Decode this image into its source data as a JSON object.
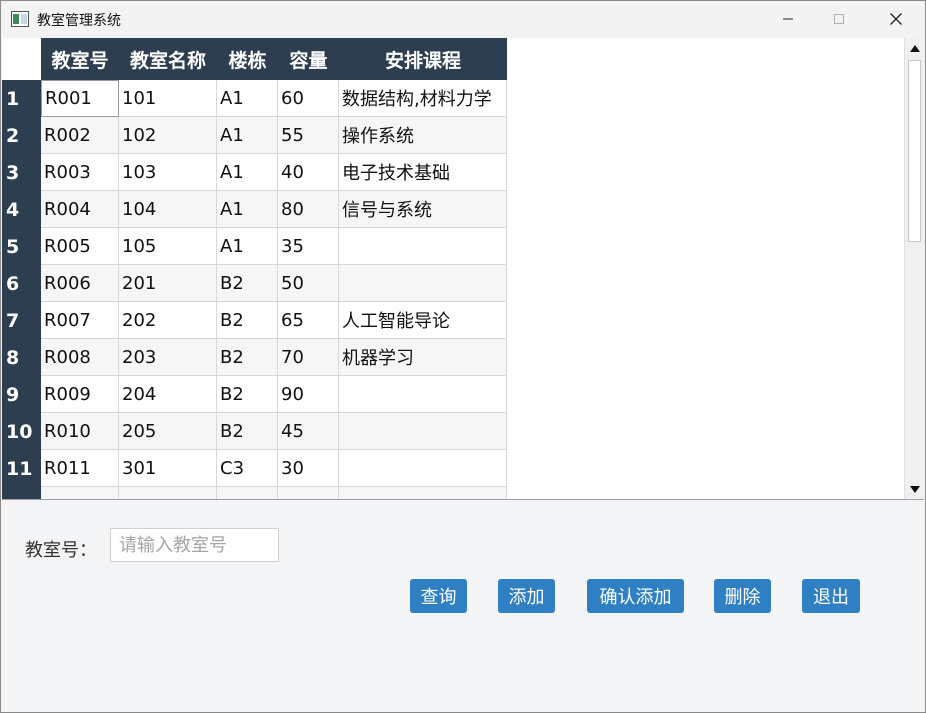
{
  "window": {
    "title": "教室管理系统"
  },
  "table": {
    "headers": [
      "教室号",
      "教室名称",
      "楼栋",
      "容量",
      "安排课程"
    ],
    "row_numbers": [
      "1",
      "2",
      "3",
      "4",
      "5",
      "6",
      "7",
      "8",
      "9",
      "10",
      "11"
    ],
    "rows": [
      [
        "R001",
        "101",
        "A1",
        "60",
        "数据结构,材料力学"
      ],
      [
        "R002",
        "102",
        "A1",
        "55",
        "操作系统"
      ],
      [
        "R003",
        "103",
        "A1",
        "40",
        "电子技术基础"
      ],
      [
        "R004",
        "104",
        "A1",
        "80",
        "信号与系统"
      ],
      [
        "R005",
        "105",
        "A1",
        "35",
        ""
      ],
      [
        "R006",
        "201",
        "B2",
        "50",
        ""
      ],
      [
        "R007",
        "202",
        "B2",
        "65",
        "人工智能导论"
      ],
      [
        "R008",
        "203",
        "B2",
        "70",
        "机器学习"
      ],
      [
        "R009",
        "204",
        "B2",
        "90",
        ""
      ],
      [
        "R010",
        "205",
        "B2",
        "45",
        ""
      ],
      [
        "R011",
        "301",
        "C3",
        "30",
        ""
      ]
    ]
  },
  "form": {
    "label": "教室号：",
    "input_placeholder": "请输入教室号",
    "input_value": ""
  },
  "buttons": {
    "query": "查询",
    "add": "添加",
    "confirm_add": "确认添加",
    "delete": "删除",
    "exit": "退出"
  },
  "colors": {
    "header_bg": "#2c3e50",
    "button_bg": "#2f80c2"
  }
}
